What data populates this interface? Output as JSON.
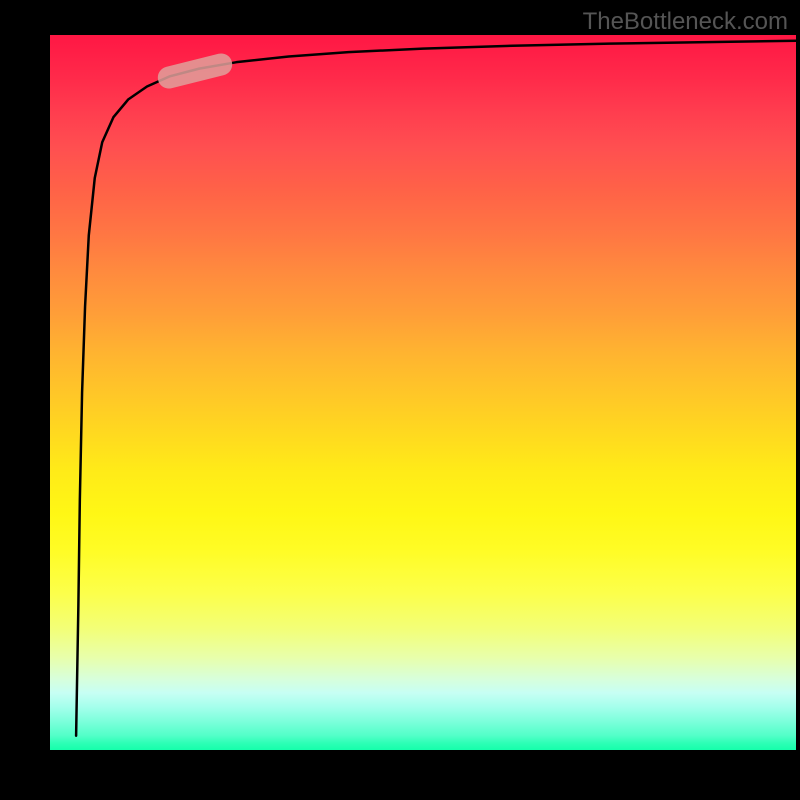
{
  "attribution": "TheBottleneck.com",
  "chart_data": {
    "type": "line",
    "title": "",
    "xlabel": "",
    "ylabel": "",
    "xlim": [
      0,
      100
    ],
    "ylim": [
      0,
      100
    ],
    "series": [
      {
        "name": "curve",
        "x": [
          3.5,
          3.8,
          4.0,
          4.3,
          4.7,
          5.2,
          6.0,
          7.0,
          8.5,
          10.5,
          13.0,
          16.0,
          20.0,
          25.0,
          32.0,
          40.0,
          50.0,
          62.0,
          75.0,
          88.0,
          100.0
        ],
        "values": [
          2,
          20,
          35,
          50,
          62,
          72,
          80,
          85,
          88.5,
          91,
          92.8,
          94.2,
          95.3,
          96.2,
          97.0,
          97.6,
          98.1,
          98.5,
          98.8,
          99.0,
          99.2
        ]
      }
    ],
    "marker": {
      "x": 19.5,
      "y": 95.0,
      "angle_deg": 14
    },
    "background_gradient": {
      "top": "#ff1744",
      "mid": "#ffeb18",
      "bottom": "#15ffab"
    }
  }
}
